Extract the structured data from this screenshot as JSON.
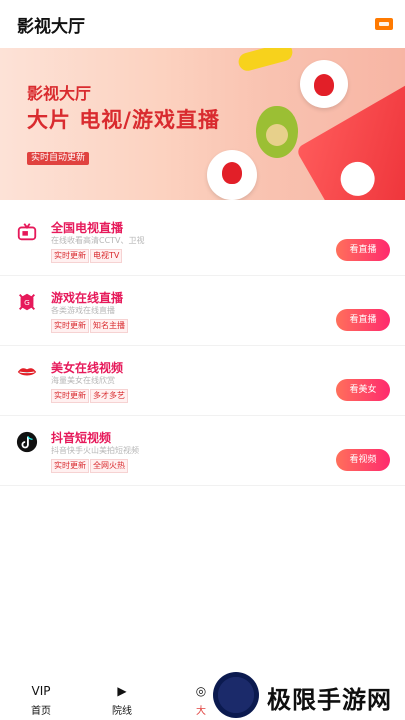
{
  "header": {
    "title": "影视大厅",
    "flag_icon": "flag-icon"
  },
  "banner": {
    "title": "影视大厅",
    "subtitle": "大片 电视/游戏直播",
    "tag": "实时自动更新"
  },
  "items": [
    {
      "name": "全国电视直播",
      "desc": "在线收看高清CCTV、卫视",
      "tag1": "实时更新",
      "tag2": "电视TV",
      "button": "看直播",
      "icon": "tv-icon"
    },
    {
      "name": "游戏在线直播",
      "desc": "各类游戏在线直播",
      "tag1": "实时更新",
      "tag2": "知名主播",
      "button": "看直播",
      "icon": "game-icon"
    },
    {
      "name": "美女在线视频",
      "desc": "海量美女在线欣赏",
      "tag1": "实时更新",
      "tag2": "多才多艺",
      "button": "看美女",
      "icon": "lips-icon"
    },
    {
      "name": "抖音短视频",
      "desc": "抖音快手火山美拍短视频",
      "tag1": "实时更新",
      "tag2": "全网火热",
      "button": "看视频",
      "icon": "tiktok-icon"
    }
  ],
  "bottom_nav": [
    {
      "label": "首页",
      "icon": "vip-icon"
    },
    {
      "label": "院线",
      "icon": "play-icon"
    },
    {
      "label": "大",
      "icon": "hall-icon"
    }
  ],
  "watermark": {
    "text": "极限手游网"
  }
}
